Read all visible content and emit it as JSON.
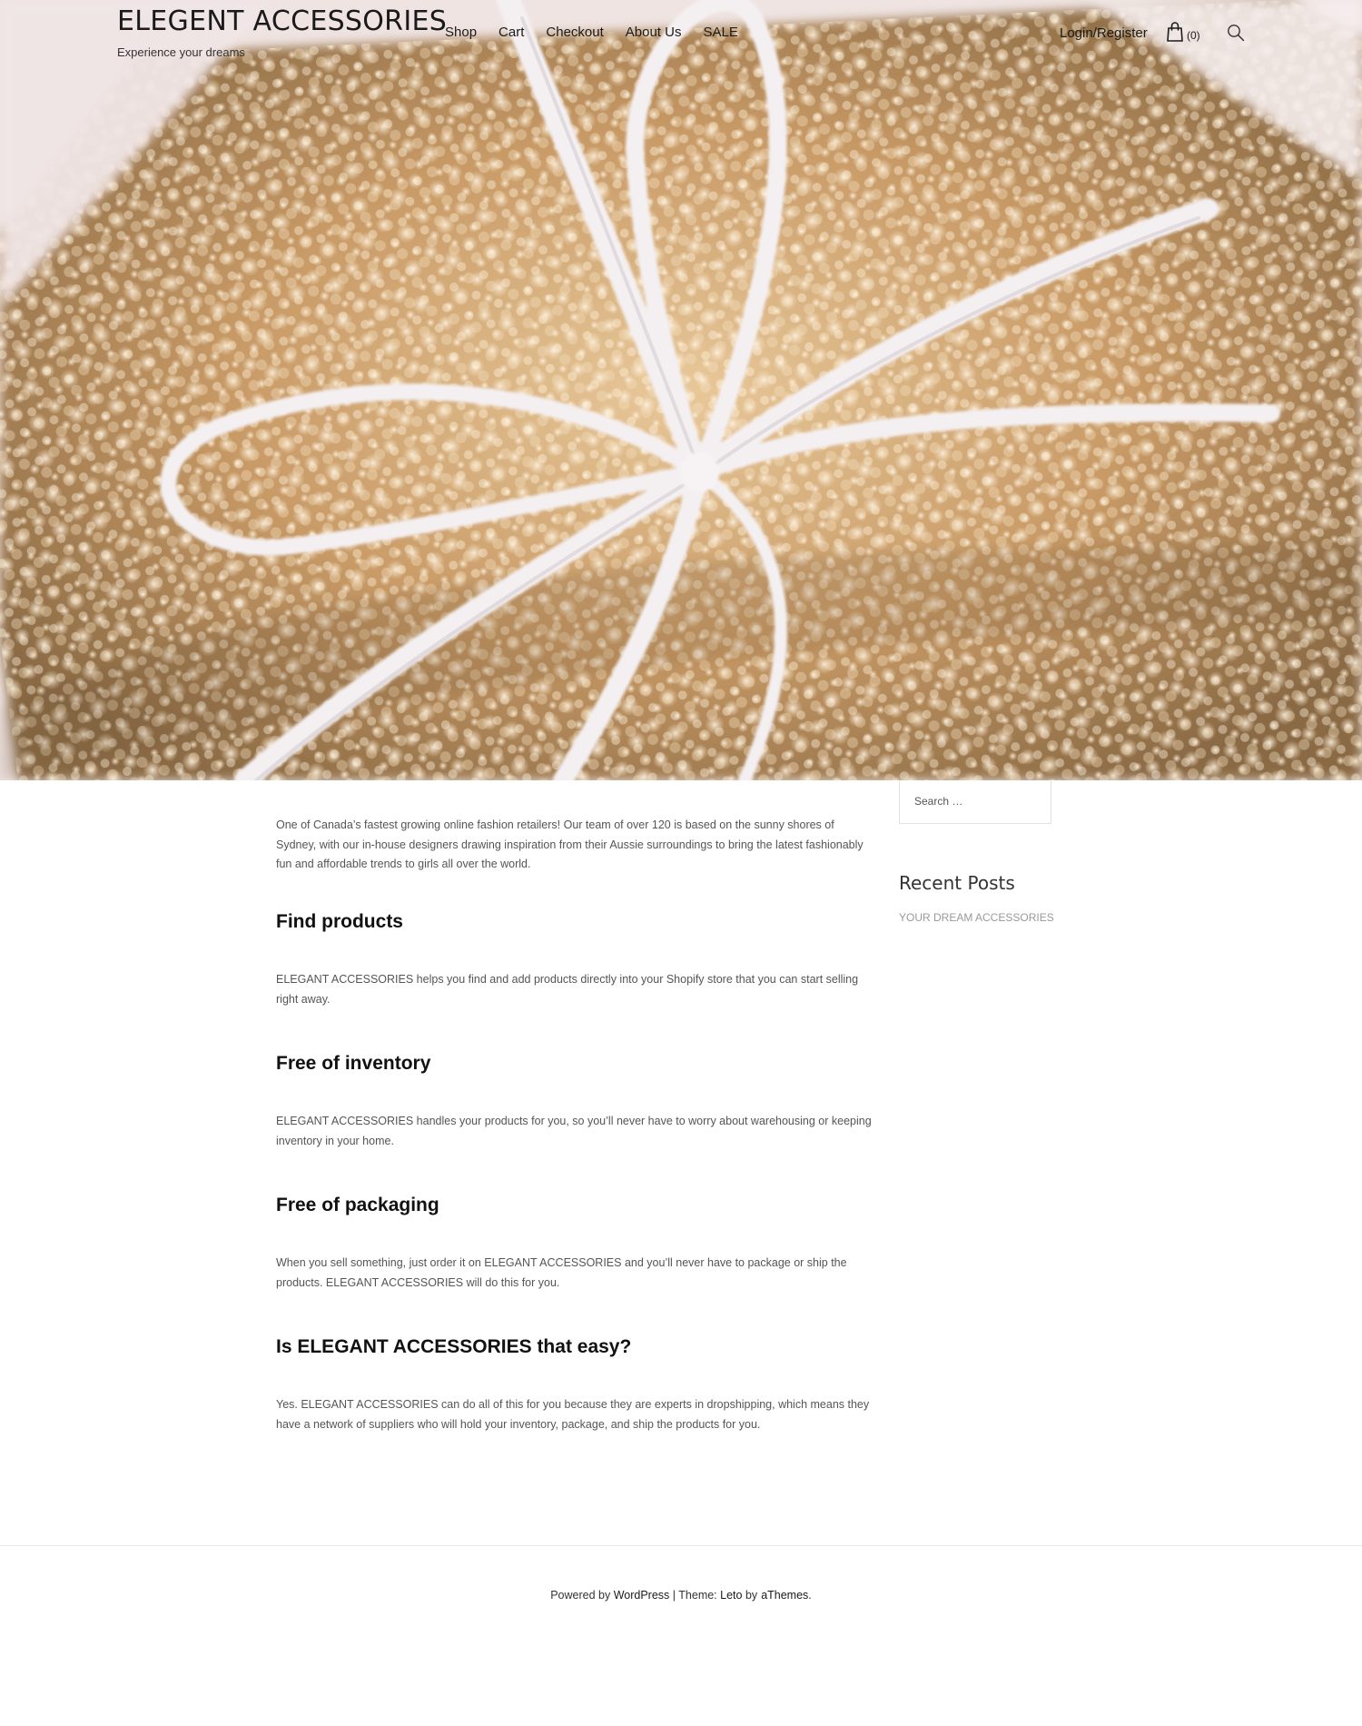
{
  "site": {
    "title": "ELEGENT ACCESSORIES",
    "tagline": "Experience your dreams"
  },
  "nav": {
    "items": [
      {
        "label": "Shop"
      },
      {
        "label": "Cart"
      },
      {
        "label": "Checkout"
      },
      {
        "label": "About Us"
      },
      {
        "label": "SALE"
      }
    ]
  },
  "header_actions": {
    "login_label": "Login/Register",
    "cart_icon": "shopping-bag-icon",
    "cart_count": "(0)",
    "search_icon": "search-icon"
  },
  "hero": {
    "image": "gold glitter gift box tied with white string bow"
  },
  "content": {
    "intro": "One of Canada’s fastest growing online fashion retailers! Our team of over 120 is based on the sunny shores of Sydney, with our in-house designers drawing inspiration from their Aussie surroundings to bring the latest fashionably fun and affordable trends to girls all over the world.",
    "sections": [
      {
        "heading": "Find products",
        "text": "ELEGANT ACCESSORIES helps you find and add products directly into your Shopify store that you can start selling right away."
      },
      {
        "heading": "Free of inventory",
        "text": "ELEGANT ACCESSORIES handles your products for you, so you’ll never have to worry about warehousing or keeping inventory in your home."
      },
      {
        "heading": "Free of packaging",
        "text": "When you sell something, just order it on ELEGANT ACCESSORIES and you’ll never have to package or ship the products. ELEGANT ACCESSORIES will do this for you."
      },
      {
        "heading": "Is ELEGANT ACCESSORIES that easy?",
        "text": "Yes. ELEGANT ACCESSORIES can do all of this for you because they are experts in dropshipping, which means they have a network of suppliers who will hold your inventory, package, and ship the products for you."
      }
    ]
  },
  "sidebar": {
    "search_placeholder": "Search …",
    "recent_posts_title": "Recent Posts",
    "recent_posts": [
      "YOUR DREAM ACCESSORIES"
    ]
  },
  "footer": {
    "powered_prefix": "Powered by",
    "powered_link": "WordPress",
    "separator": "|",
    "theme_prefix": "Theme:",
    "theme_link": "Leto",
    "by_text": "by",
    "author_link": "aThemes",
    "period": "."
  },
  "colors": {
    "text_dark": "#1a1a1a",
    "body_text": "#555555",
    "muted": "#999999",
    "gold": "#c9a06a"
  }
}
